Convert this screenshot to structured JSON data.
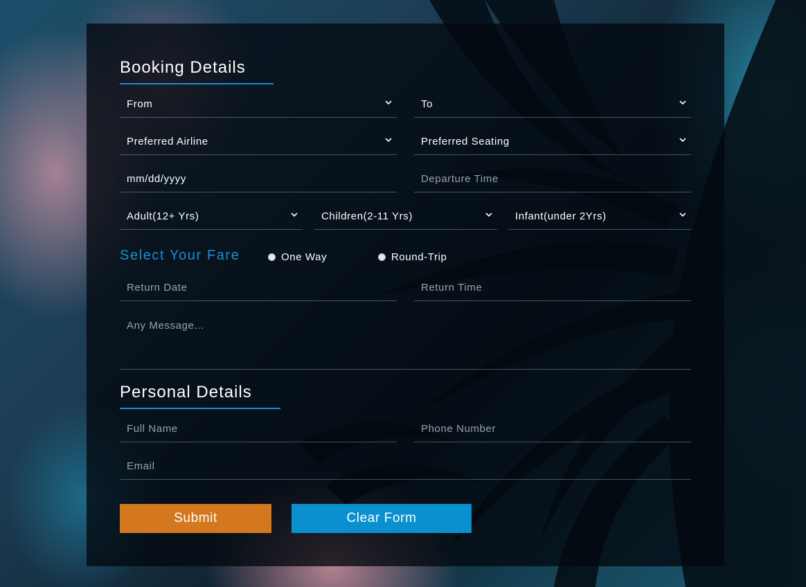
{
  "booking": {
    "title": "Booking Details",
    "from": "From",
    "to": "To",
    "airline": "Preferred Airline",
    "seating": "Preferred Seating",
    "date": "mm/dd/yyyy",
    "departure_time": "Departure Time",
    "adult": "Adult(12+ Yrs)",
    "children": "Children(2-11 Yrs)",
    "infant": "Infant(under 2Yrs)"
  },
  "fare": {
    "title": "Select Your Fare",
    "options": [
      "One Way",
      "Round-Trip"
    ],
    "return_date": "Return Date",
    "return_time": "Return Time",
    "message_placeholder": "Any Message..."
  },
  "personal": {
    "title": "Personal Details",
    "full_name": "Full Name",
    "phone": "Phone Number",
    "email": "Email"
  },
  "actions": {
    "submit": "Submit",
    "clear": "Clear Form"
  },
  "colors": {
    "accent": "#1a8fd0",
    "submit": "#d4781f",
    "clear": "#0a90cf"
  },
  "icons": {
    "dropdown": "chevron-down-icon",
    "radio": "radio-unchecked-icon"
  }
}
